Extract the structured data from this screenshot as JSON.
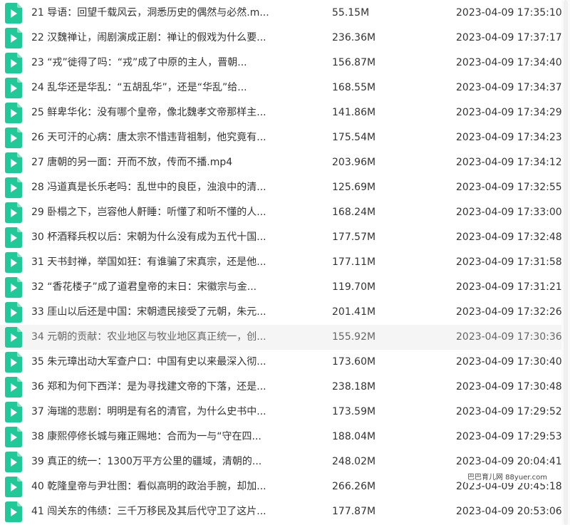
{
  "colors": {
    "icon": "#20c997",
    "highlight": "#f5f5f5",
    "text": "#333333"
  },
  "icon_name": "video-file-icon",
  "files": [
    {
      "name": "21 导语：回望千载风云，洞悉历史的偶然与必然.m...",
      "size": "55.15M",
      "date": "2023-04-09 17:35:10"
    },
    {
      "name": "22 汉魏禅让，闹剧演成正剧：禅让的假戏为什么要...",
      "size": "236.36M",
      "date": "2023-04-09 17:37:17"
    },
    {
      "name": "23 “戎”徙得了吗：“戎”成了中原的主人，晋朝...",
      "size": "156.87M",
      "date": "2023-04-09 17:34:40"
    },
    {
      "name": "24 乱华还是华乱：“五胡乱华”，还是“华乱”给...",
      "size": "168.55M",
      "date": "2023-04-09 17:34:37"
    },
    {
      "name": "25 鲜卑华化：没有哪个皇帝，像北魏孝文帝那样主...",
      "size": "141.86M",
      "date": "2023-04-09 17:34:29"
    },
    {
      "name": "26 天可汗的心病：唐太宗不惜违背祖制，他究竟有...",
      "size": "175.54M",
      "date": "2023-04-09 17:34:23"
    },
    {
      "name": "27 唐朝的另一面：开而不放，传而不播.mp4",
      "size": "203.96M",
      "date": "2023-04-09 17:34:12"
    },
    {
      "name": "28 冯道真是长乐老吗：乱世中的良臣，浊浪中的清...",
      "size": "125.69M",
      "date": "2023-04-09 17:32:55"
    },
    {
      "name": "29 卧榻之下，岂容他人鼾睡：听懂了和听不懂的人...",
      "size": "168.24M",
      "date": "2023-04-09 17:33:00"
    },
    {
      "name": "30 杯酒释兵权以后：宋朝为什么没有成为五代十国...",
      "size": "177.57M",
      "date": "2023-04-09 17:32:48"
    },
    {
      "name": "31 天书封禅，举国如狂：有谁骗了宋真宗，还是他...",
      "size": "177.11M",
      "date": "2023-04-09 17:31:58"
    },
    {
      "name": "32 “香花楼子”成了道君皇帝的末日：宋徽宗与金...",
      "size": "119.70M",
      "date": "2023-04-09 17:31:21"
    },
    {
      "name": "33 厓山以后还是中国：宋朝遗民接受了元朝，朱元...",
      "size": "201.41M",
      "date": "2023-04-09 17:32:26"
    },
    {
      "name": "34 元朝的贡献：农业地区与牧业地区真正统一，创...",
      "size": "155.92M",
      "date": "2023-04-09 17:30:36",
      "highlight": true
    },
    {
      "name": "35 朱元璋出动大军查户口：中国有史以来最深入彻...",
      "size": "173.60M",
      "date": "2023-04-09 17:30:40"
    },
    {
      "name": "36 郑和为何下西洋：是为寻找建文帝的下落，还是...",
      "size": "238.18M",
      "date": "2023-04-09 17:30:48"
    },
    {
      "name": "37 海瑞的悲剧：明明是有名的清官，为什么史书中...",
      "size": "173.59M",
      "date": "2023-04-09 17:29:52"
    },
    {
      "name": "38 康熙停修长城与雍正赐地：合而为一与“守在四...",
      "size": "188.04M",
      "date": "2023-04-09 17:29:53"
    },
    {
      "name": "39 真正的统一：1300万平方公里的疆域，清朝的...",
      "size": "248.02M",
      "date": "2023-04-09 20:04:41"
    },
    {
      "name": "40 乾隆皇帝与尹壮图：看似高明的政治手腕，却加...",
      "size": "266.26M",
      "date": "2023-04-09 20:45:18"
    },
    {
      "name": "41 闯关东的伟绩：三千万移民及其后代守卫了这片...",
      "size": "177.87M",
      "date": "2023-04-09 20:53:06"
    }
  ],
  "watermark": "巴巴育儿网 88yuer.com"
}
